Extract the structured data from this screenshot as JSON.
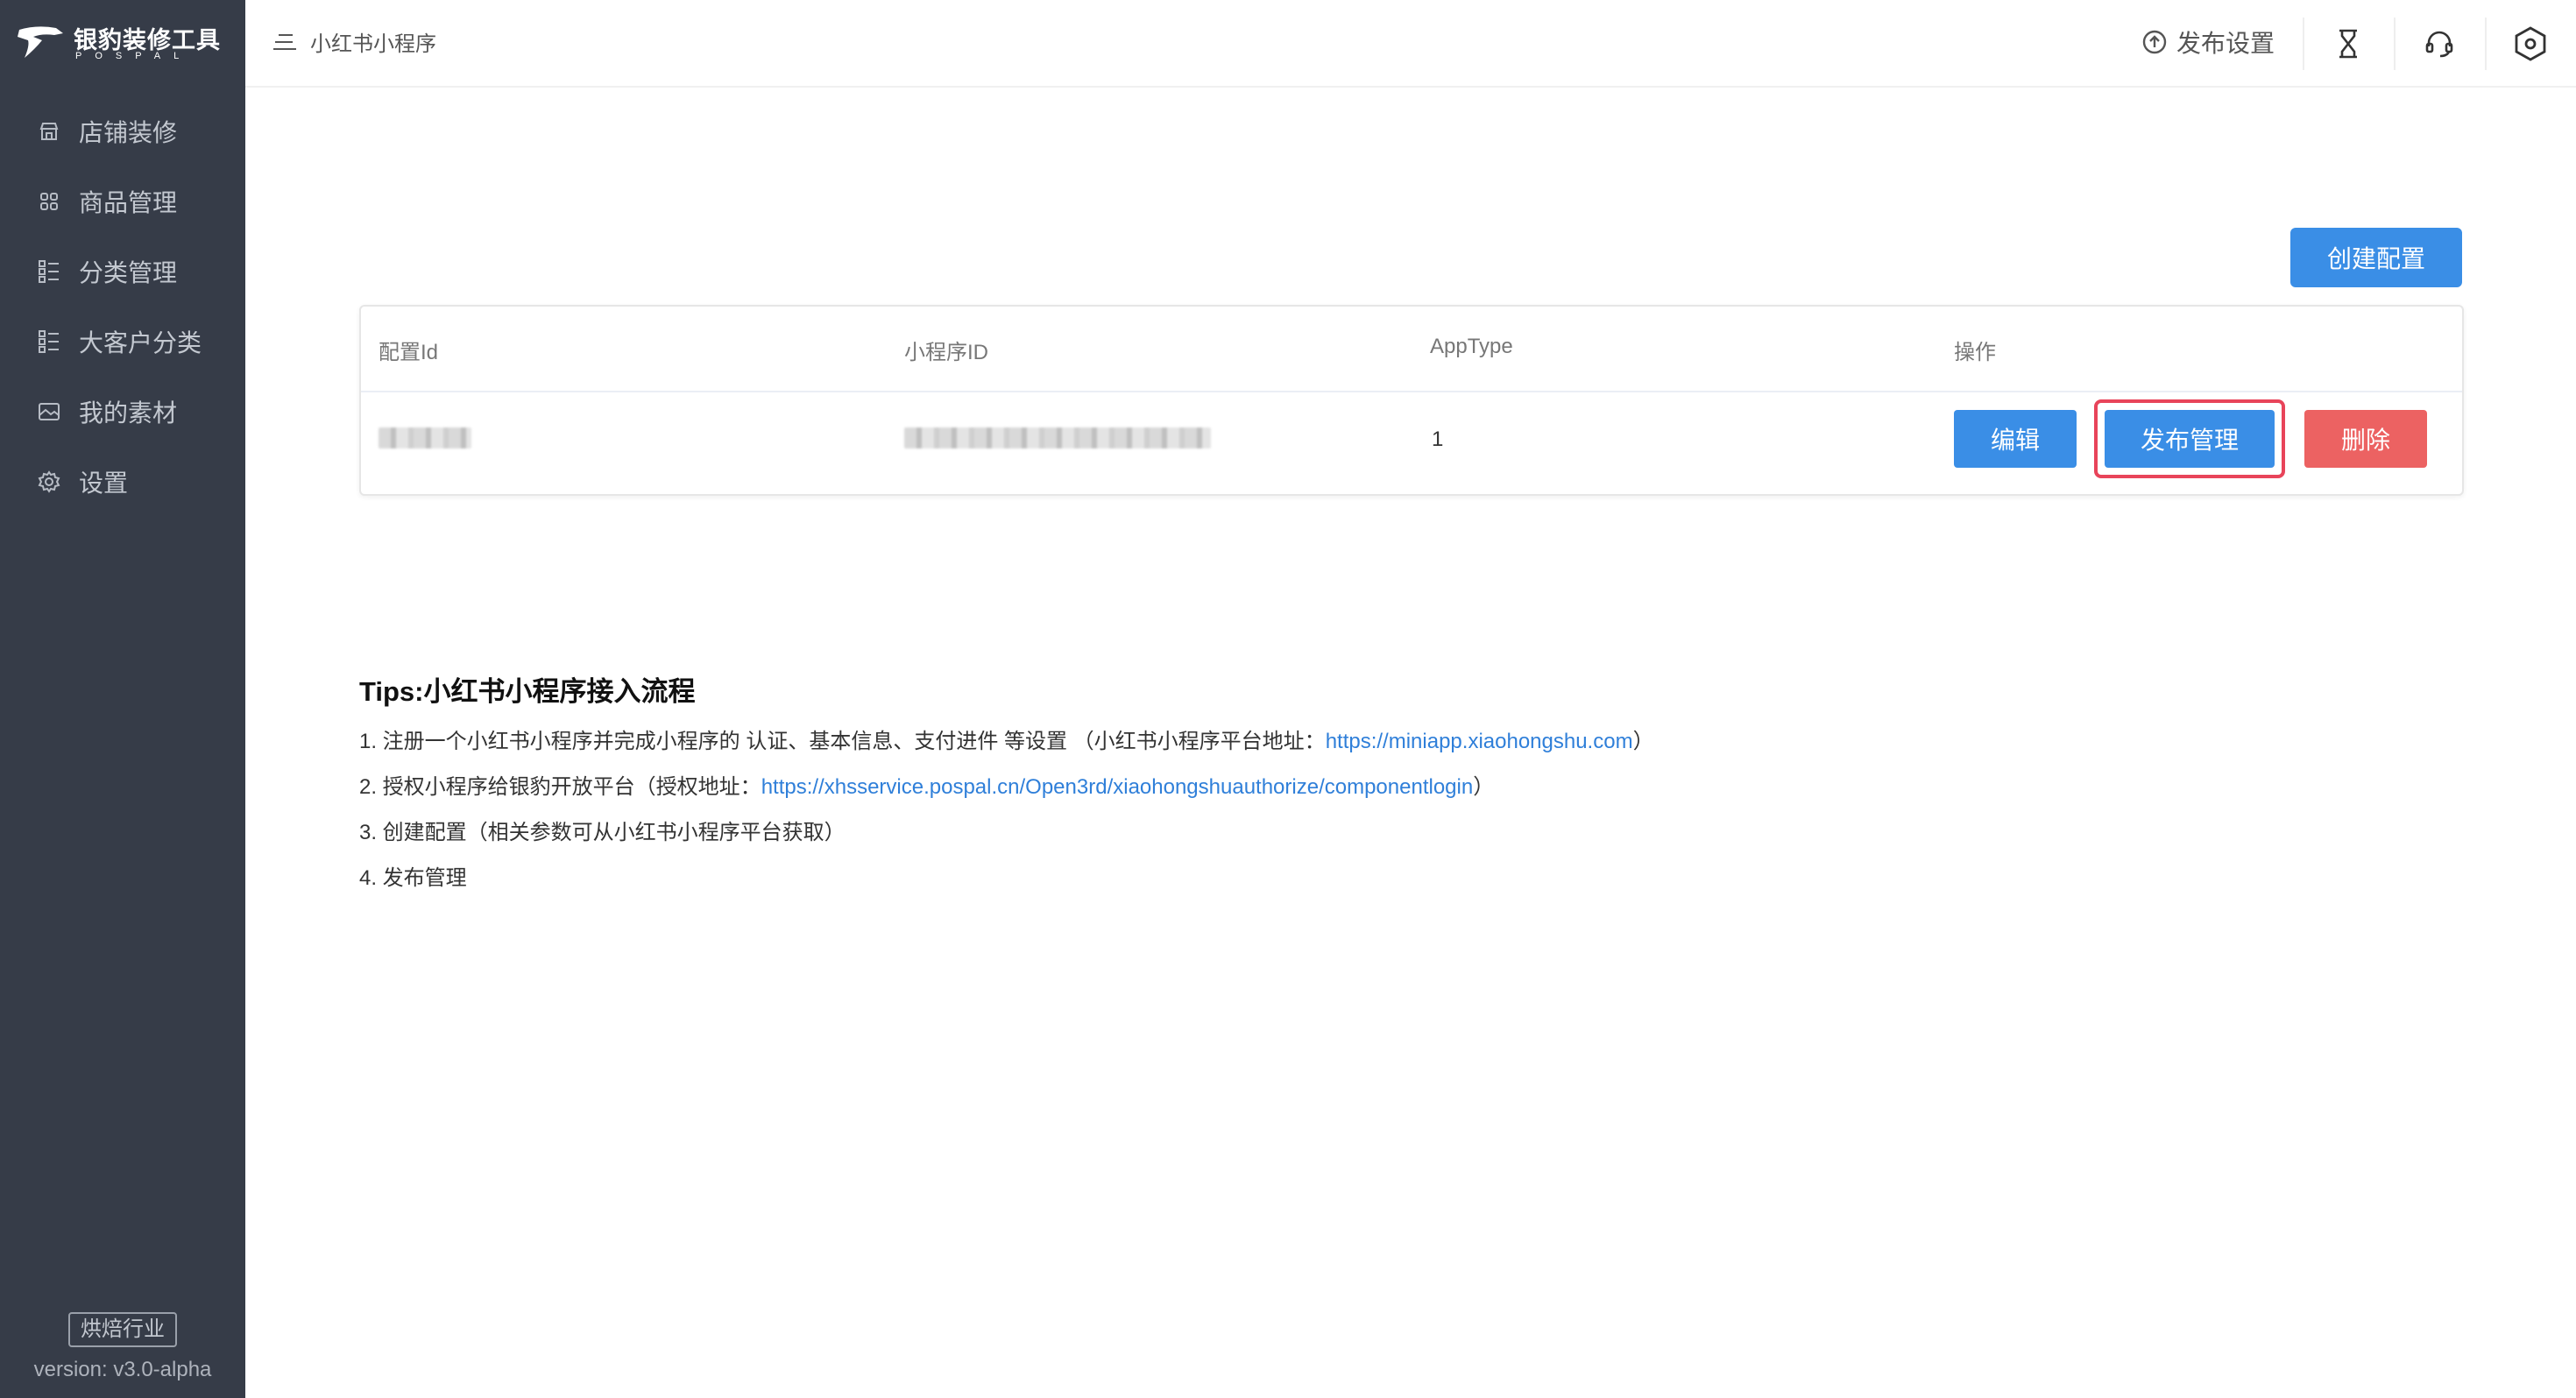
{
  "sidebar": {
    "logo_name": "银豹装修工具",
    "logo_sub": "POSPAL",
    "items": [
      {
        "label": "店铺装修",
        "icon": "shop-icon"
      },
      {
        "label": "商品管理",
        "icon": "grid-icon"
      },
      {
        "label": "分类管理",
        "icon": "category-list-icon"
      },
      {
        "label": "大客户分类",
        "icon": "category-list-icon"
      },
      {
        "label": "我的素材",
        "icon": "image-icon"
      },
      {
        "label": "设置",
        "icon": "gear-icon"
      }
    ],
    "industry_badge": "烘焙行业",
    "version": "version: v3.0-alpha"
  },
  "header": {
    "breadcrumb": "小红书小程序",
    "publish_settings": "发布设置",
    "icons": [
      "hourglass-icon",
      "headset-icon",
      "hexagon-settings-icon"
    ]
  },
  "main": {
    "create_button": "创建配置",
    "table": {
      "columns": [
        "配置Id",
        "小程序ID",
        "AppType",
        "操作"
      ],
      "rows": [
        {
          "config_id": "",
          "miniapp_id": "",
          "app_type": "1",
          "actions": {
            "edit": "编辑",
            "publish": "发布管理",
            "delete": "删除"
          }
        }
      ]
    }
  },
  "tips": {
    "title": "Tips:小红书小程序接入流程",
    "line1_text": "1. 注册一个小红书小程序并完成小程序的 认证、基本信息、支付进件 等设置 （小红书小程序平台地址：",
    "line1_link": "https://miniapp.xiaohongshu.com",
    "line1_end": "）",
    "line2_text": "2. 授权小程序给银豹开放平台（授权地址：",
    "line2_link": "https://xhsservice.pospal.cn/Open3rd/xiaohongshuauthorize/componentlogin",
    "line2_end": "）",
    "line3": "3. 创建配置（相关参数可从小红书小程序平台获取）",
    "line4": "4. 发布管理"
  },
  "colors": {
    "sidebar_bg": "#363c48",
    "primary": "#3a8ee6",
    "danger": "#ec6262",
    "highlight": "#e8445a",
    "link": "#2f7fd9"
  }
}
